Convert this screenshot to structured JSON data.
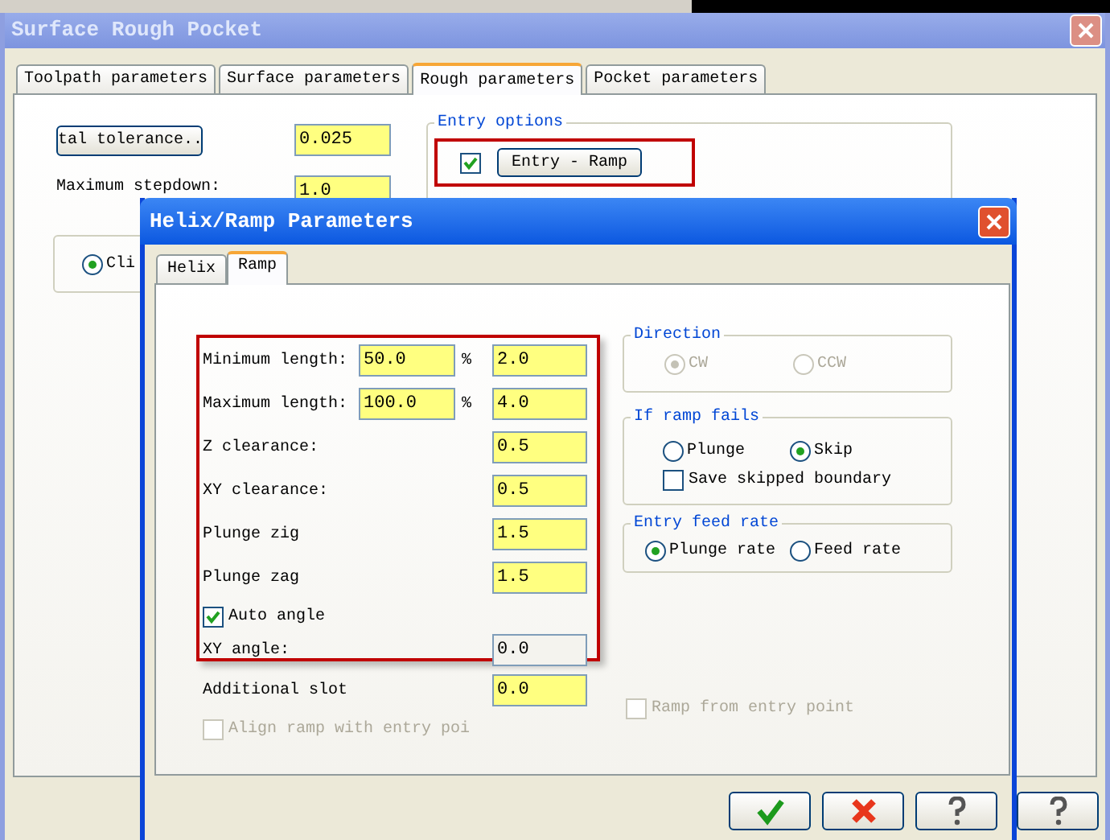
{
  "main_window": {
    "title": "Surface Rough Pocket",
    "tabs": [
      {
        "label": "Toolpath parameters",
        "selected": false
      },
      {
        "label": "Surface parameters",
        "selected": false
      },
      {
        "label": "Rough parameters",
        "selected": true
      },
      {
        "label": "Pocket parameters",
        "selected": false
      }
    ],
    "tolerance_button": "tal tolerance..",
    "tolerance_value": "0.025",
    "stepdown_label": "Maximum stepdown:",
    "stepdown_value": "1.0",
    "cut_radio": {
      "label": "Cli",
      "selected": true
    },
    "entry_options": {
      "title": "Entry options",
      "checked": true,
      "button": "Entry - Ramp",
      "highlighted": true
    },
    "buttons": [
      {
        "kind": "help"
      }
    ]
  },
  "dialog": {
    "title": "Helix/Ramp Parameters",
    "tabs": [
      {
        "label": "Helix",
        "selected": false
      },
      {
        "label": "Ramp",
        "selected": true
      }
    ],
    "ramp_settings": {
      "highlighted": true,
      "rows": [
        {
          "label": "Minimum length:",
          "percent": "50.0",
          "unit": "%",
          "value": "2.0"
        },
        {
          "label": "Maximum length:",
          "percent": "100.0",
          "unit": "%",
          "value": "4.0"
        },
        {
          "label": "Z clearance:",
          "value": "0.5"
        },
        {
          "label": "XY clearance:",
          "value": "0.5"
        },
        {
          "label": "Plunge zig",
          "value": "1.5"
        },
        {
          "label": "Plunge zag",
          "value": "1.5"
        }
      ],
      "auto_angle": {
        "label": "Auto angle",
        "checked": true
      },
      "xy_angle": {
        "label": "XY angle:",
        "value": "0.0",
        "disabled": true
      }
    },
    "additional_slot": {
      "label": "Additional slot",
      "value": "0.0"
    },
    "align_ramp": {
      "label": "Align ramp with entry poi",
      "checked": false,
      "disabled": true
    },
    "direction": {
      "title": "Direction",
      "disabled": true,
      "options": [
        {
          "label": "CW",
          "selected": true
        },
        {
          "label": "CCW",
          "selected": false
        }
      ]
    },
    "if_ramp_fails": {
      "title": "If ramp fails",
      "options": [
        {
          "label": "Plunge",
          "selected": false
        },
        {
          "label": "Skip",
          "selected": true
        }
      ],
      "save_skipped": {
        "label": "Save skipped boundary",
        "checked": false
      }
    },
    "entry_feed_rate": {
      "title": "Entry feed rate",
      "options": [
        {
          "label": "Plunge rate",
          "selected": true
        },
        {
          "label": "Feed rate",
          "selected": false
        }
      ]
    },
    "ramp_from_entry": {
      "label": "Ramp from entry point",
      "checked": false,
      "disabled": true
    },
    "buttons": [
      {
        "kind": "ok"
      },
      {
        "kind": "cancel"
      },
      {
        "kind": "help"
      }
    ]
  }
}
